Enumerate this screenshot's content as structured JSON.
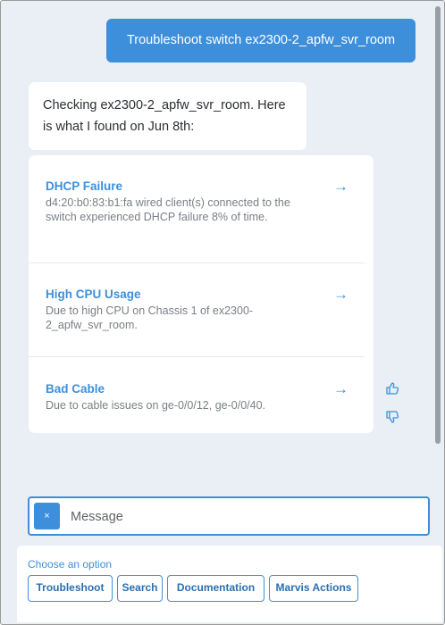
{
  "conversation": {
    "user_message": "Troubleshoot switch ex2300-2_apfw_svr_room",
    "bot_intro": "Checking ex2300-2_apfw_svr_room. Here is what I found on Jun 8th:",
    "findings": [
      {
        "title": "DHCP Failure",
        "description": "d4:20:b0:83:b1:fa wired client(s) connected to the switch experienced DHCP failure 8% of time.",
        "arrow": "→"
      },
      {
        "title": "High CPU Usage",
        "description": "Due to high CPU on Chassis 1 of ex2300-2_apfw_svr_room.",
        "arrow": "→"
      },
      {
        "title": "Bad Cable",
        "description": "Due to cable issues on ge-0/0/12, ge-0/0/40.",
        "arrow": "→"
      }
    ],
    "feedback": {
      "thumbs_up_icon": "thumbs-up-icon",
      "thumbs_down_icon": "thumbs-down-icon"
    }
  },
  "input": {
    "clear_label": "×",
    "placeholder": "Message",
    "value": ""
  },
  "options": {
    "label": "Choose an option",
    "buttons": [
      "Troubleshoot",
      "Search",
      "Documentation",
      "Marvis Actions"
    ]
  },
  "colors": {
    "accent": "#3d8fdb",
    "background": "#e9eff4",
    "muted_text": "#7a7f85"
  }
}
